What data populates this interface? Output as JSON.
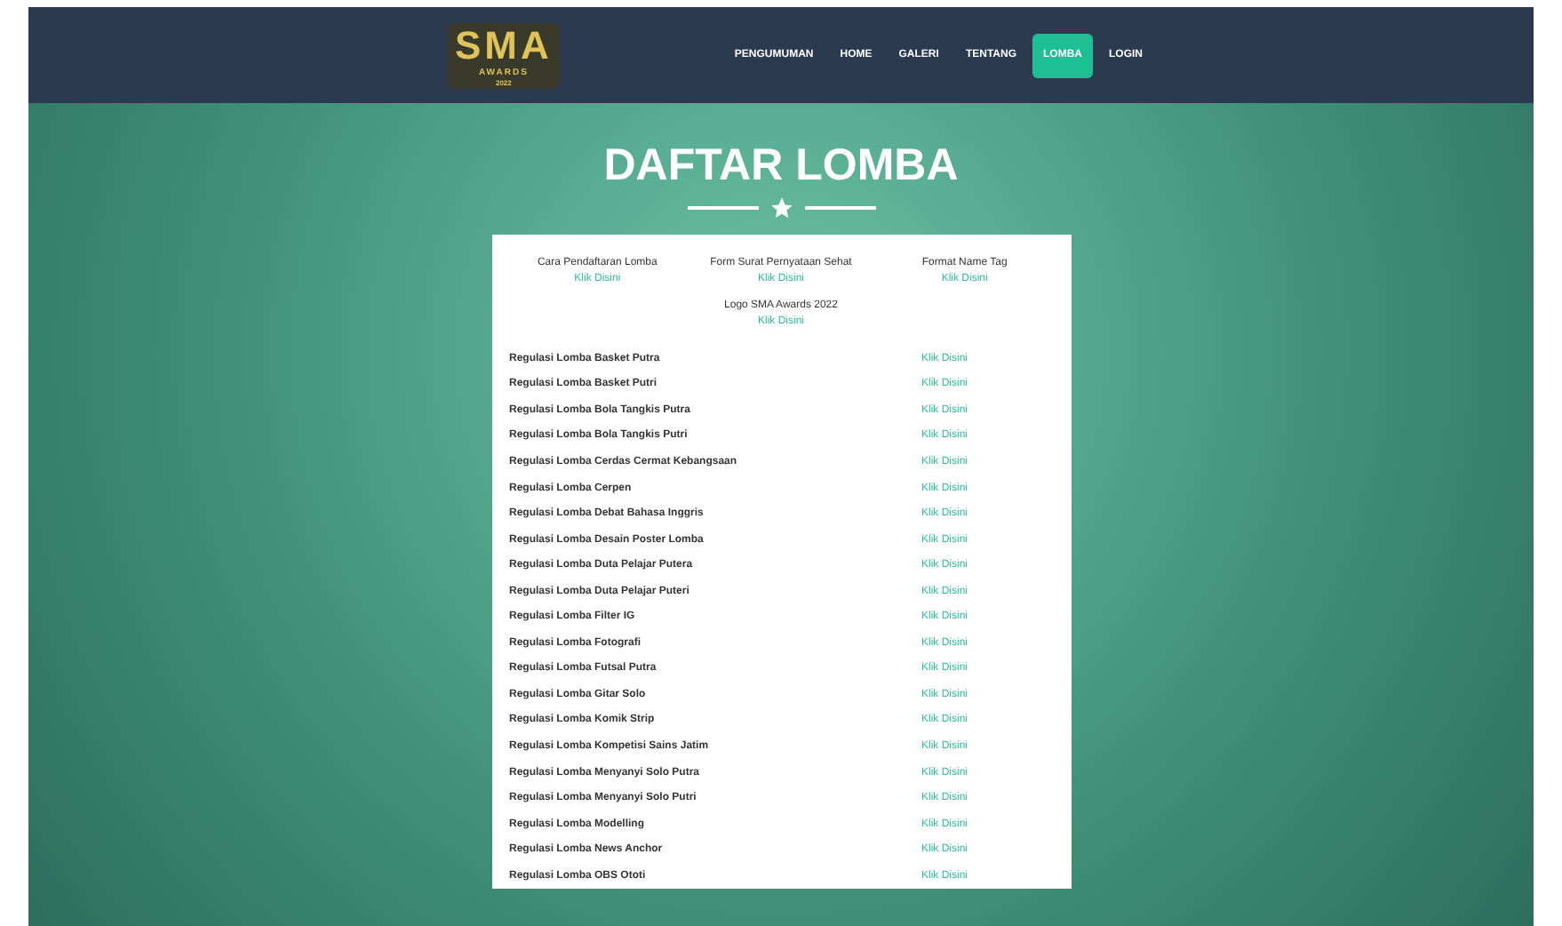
{
  "logo": {
    "title": "SMA",
    "subtitle": "AWARDS",
    "year": "2022"
  },
  "nav": [
    {
      "label": "PENGUMUMAN",
      "selected": false
    },
    {
      "label": "HOME",
      "selected": false
    },
    {
      "label": "GALERI",
      "selected": false
    },
    {
      "label": "TENTANG",
      "selected": false
    },
    {
      "label": "LOMBA",
      "selected": true
    },
    {
      "label": "LOGIN",
      "selected": false
    }
  ],
  "heading": "DAFTAR LOMBA",
  "top_links": [
    {
      "label": "Cara Pendaftaran Lomba",
      "link": "Klik Disini"
    },
    {
      "label": "Form Surat Pernyataan Sehat",
      "link": "Klik Disini"
    },
    {
      "label": "Format Name Tag",
      "link": "Klik Disini"
    },
    {
      "label": "Logo SMA Awards 2022",
      "link": "Klik Disini"
    }
  ],
  "rows": [
    {
      "name": "Regulasi Lomba Basket Putra",
      "link": "Klik Disini"
    },
    {
      "name": "Regulasi Lomba Basket Putri",
      "link": "Klik Disini"
    },
    {
      "name": "Regulasi Lomba Bola Tangkis Putra",
      "link": "Klik Disini"
    },
    {
      "name": "Regulasi Lomba Bola Tangkis Putri",
      "link": "Klik Disini"
    },
    {
      "name": "Regulasi Lomba Cerdas Cermat Kebangsaan",
      "link": "Klik Disini"
    },
    {
      "name": "Regulasi Lomba Cerpen",
      "link": "Klik Disini"
    },
    {
      "name": "Regulasi Lomba Debat Bahasa Inggris",
      "link": "Klik Disini"
    },
    {
      "name": "Regulasi Lomba Desain Poster Lomba",
      "link": "Klik Disini"
    },
    {
      "name": "Regulasi Lomba Duta Pelajar Putera",
      "link": "Klik Disini"
    },
    {
      "name": "Regulasi Lomba Duta Pelajar Puteri",
      "link": "Klik Disini"
    },
    {
      "name": "Regulasi Lomba Filter IG",
      "link": "Klik Disini"
    },
    {
      "name": "Regulasi Lomba Fotografi",
      "link": "Klik Disini"
    },
    {
      "name": "Regulasi Lomba Futsal Putra",
      "link": "Klik Disini"
    },
    {
      "name": "Regulasi Lomba Gitar Solo",
      "link": "Klik Disini"
    },
    {
      "name": "Regulasi Lomba Komik Strip",
      "link": "Klik Disini"
    },
    {
      "name": "Regulasi Lomba Kompetisi Sains Jatim",
      "link": "Klik Disini"
    },
    {
      "name": "Regulasi Lomba Menyanyi Solo Putra",
      "link": "Klik Disini"
    },
    {
      "name": "Regulasi Lomba Menyanyi Solo Putri",
      "link": "Klik Disini"
    },
    {
      "name": "Regulasi Lomba Modelling",
      "link": "Klik Disini"
    },
    {
      "name": "Regulasi Lomba News Anchor",
      "link": "Klik Disini"
    },
    {
      "name": "Regulasi Lomba OBS Ototi",
      "link": "Klik Disini"
    }
  ]
}
